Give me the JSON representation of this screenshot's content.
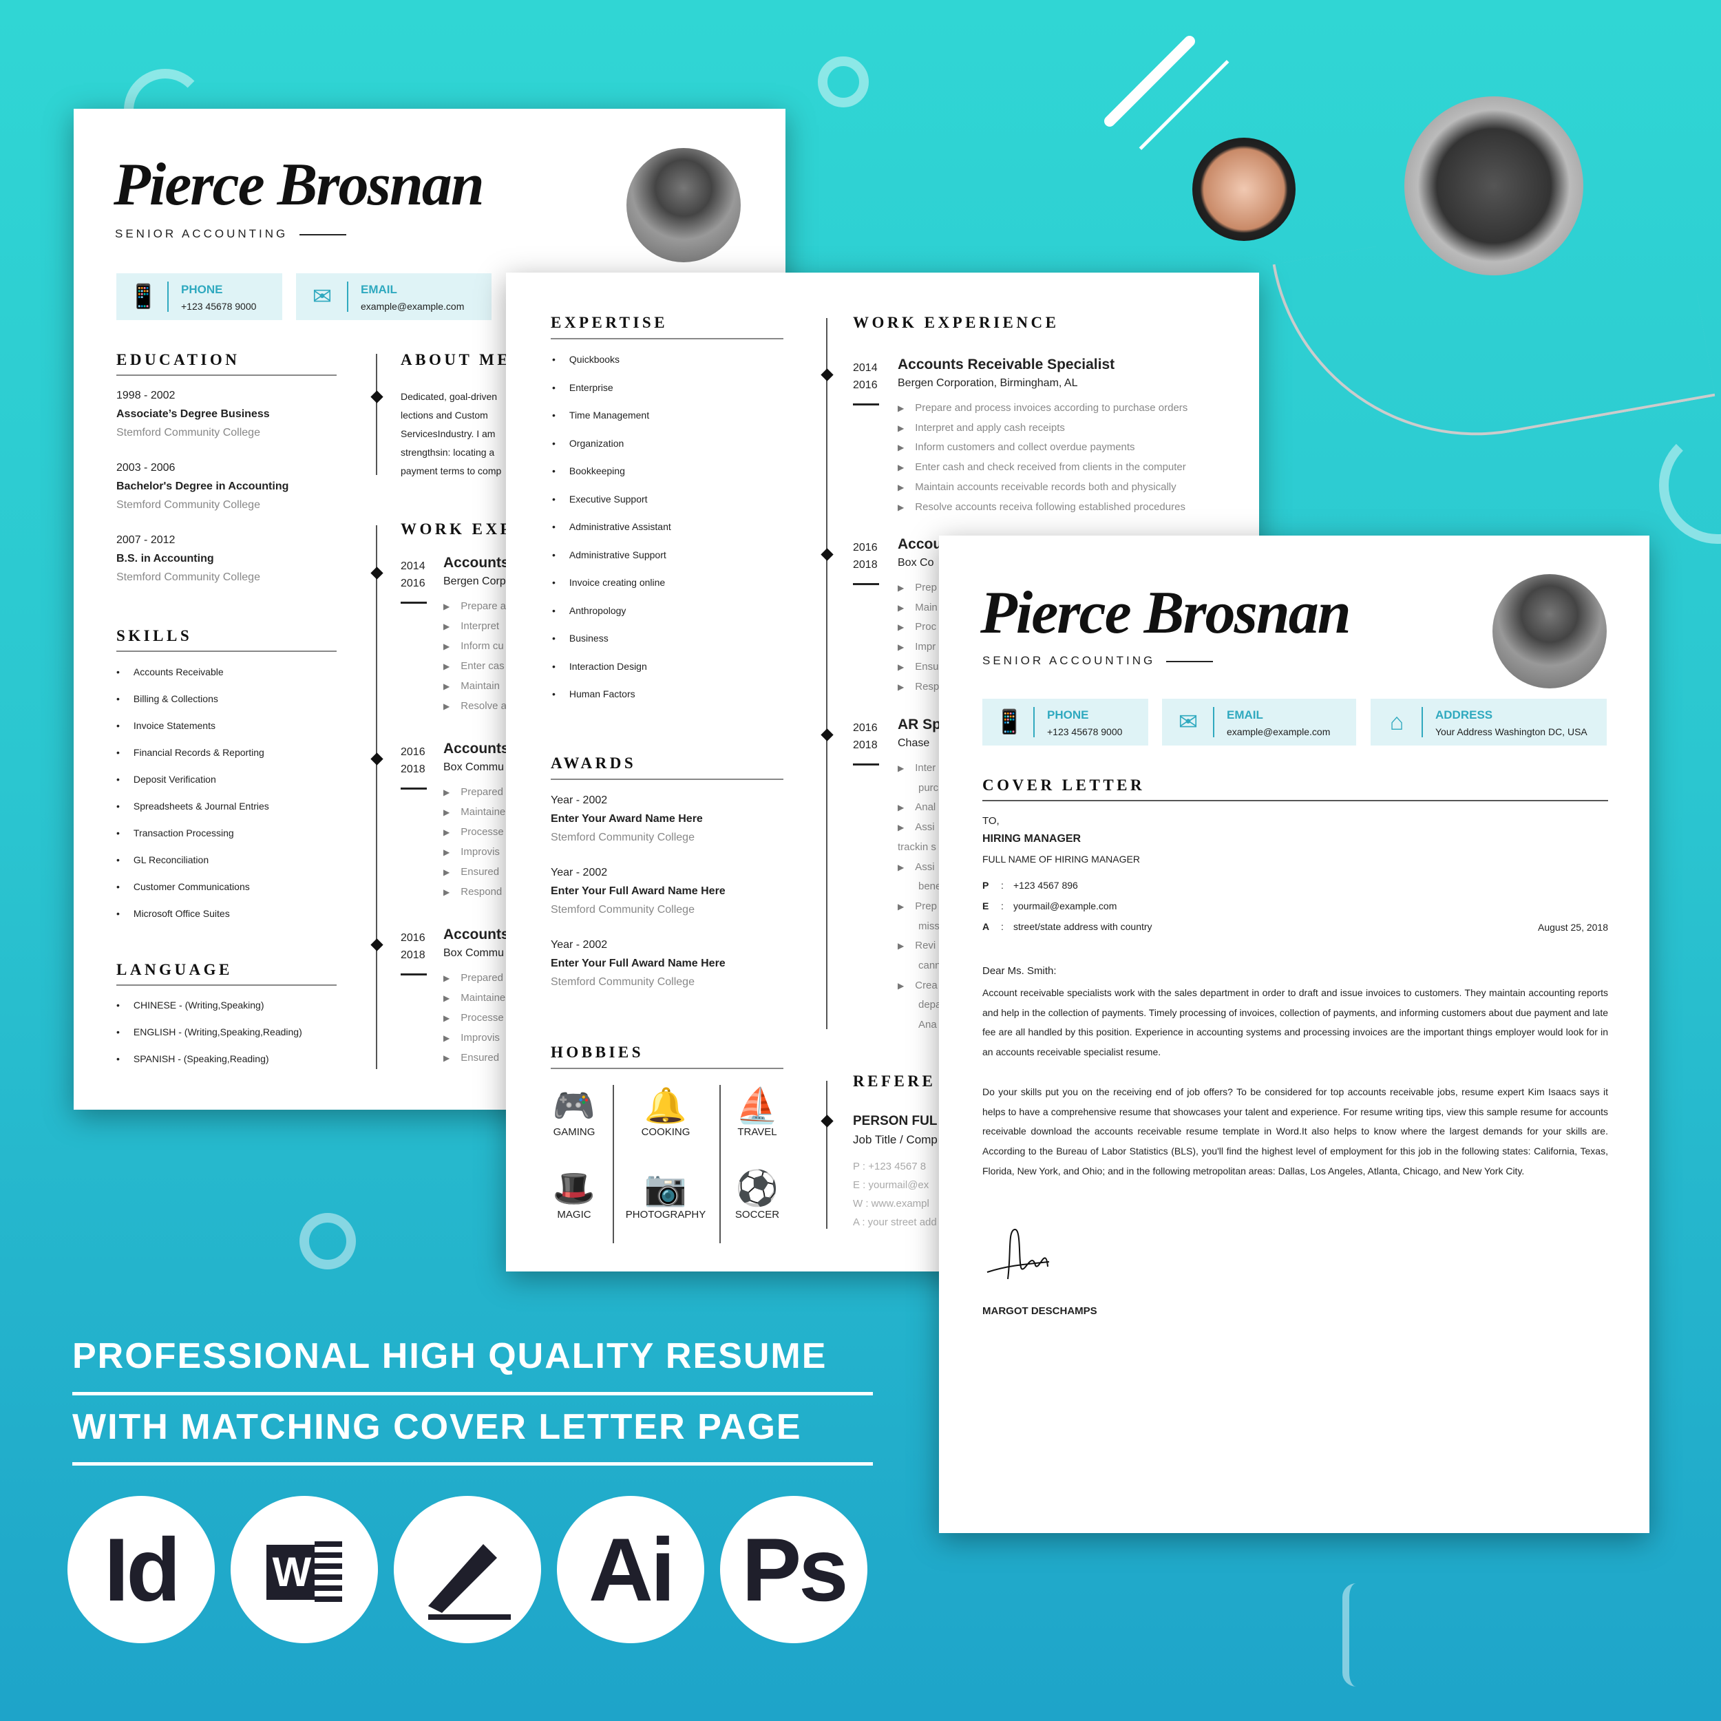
{
  "colors": {
    "accent": "#2fa9bf",
    "background_top": "#30d6d4",
    "background_bottom": "#1ea4c9",
    "contact_box": "#dff3f6"
  },
  "resume_front": {
    "name": "Pierce Brosnan",
    "title": "SENIOR ACCOUNTING",
    "contacts": [
      {
        "label": "PHONE",
        "value": "+123 45678 9000",
        "icon": "phone-icon"
      },
      {
        "label": "EMAIL",
        "value": "example@example.com",
        "icon": "envelope-icon"
      }
    ],
    "education_heading": "EDUCATION",
    "education": [
      {
        "years": "1998 - 2002",
        "degree": "Associate’s Degree Business",
        "school": "Stemford Community College"
      },
      {
        "years": "2003 - 2006",
        "degree": "Bachelor's Degree in Accounting",
        "school": "Stemford Community College"
      },
      {
        "years": "2007 - 2012",
        "degree": "B.S. in Accounting",
        "school": "Stemford Community College"
      }
    ],
    "skills_heading": "SKILLS",
    "skills": [
      "Accounts Receivable",
      "Billing & Collections",
      "Invoice Statements",
      "Financial Records & Reporting",
      "Deposit Verification",
      "Spreadsheets & Journal Entries",
      "Transaction Processing",
      "GL Reconciliation",
      "Customer Communications",
      "Microsoft Office Suites"
    ],
    "language_heading": "LANGUAGE",
    "languages": [
      "CHINESE  -  (Writing,Speaking)",
      "ENGLISH  -  (Writing,Speaking,Reading)",
      "SPANISH  -  (Speaking,Reading)"
    ],
    "about_heading": "ABOUT ME",
    "about_lines": [
      "Dedicated, goal-driven",
      "lections   and   Custom",
      "ServicesIndustry. I am",
      "strengthsin: locating a",
      "payment terms to comp"
    ],
    "work_heading": "WORK EXP",
    "work": [
      {
        "start": "2014",
        "end": "2016",
        "title": "Accounts",
        "company": "Bergen Corp",
        "bullets": [
          "Prepare a",
          "Interpret",
          "Inform cu",
          "Enter cas",
          "Maintain",
          "Resolve a"
        ]
      },
      {
        "start": "2016",
        "end": "2018",
        "title": "Accounts",
        "company": "Box Commu",
        "bullets": [
          "Prepared",
          "Maintaine",
          "Processe",
          "Improvis",
          "Ensured",
          "Respond"
        ]
      },
      {
        "start": "2016",
        "end": "2018",
        "title": "Accounts",
        "company": "Box Commu",
        "bullets": [
          "Prepared",
          "Maintaine",
          "Processe",
          "Improvis",
          "Ensured"
        ]
      }
    ]
  },
  "resume_back": {
    "expertise_heading": "EXPERTISE",
    "expertise": [
      "Quickbooks",
      "Enterprise",
      "Time Management",
      "Organization",
      "Bookkeeping",
      "Executive Support",
      "Administrative Assistant",
      "Administrative Support",
      "Invoice creating online",
      "Anthropology",
      "Business",
      "Interaction Design",
      "Human Factors"
    ],
    "awards_heading": "AWARDS",
    "awards": [
      {
        "year": "Year - 2002",
        "name": "Enter Your Award Name Here",
        "school": "Stemford Community College"
      },
      {
        "year": "Year - 2002",
        "name": "Enter Your Full Award Name Here",
        "school": "Stemford Community College"
      },
      {
        "year": "Year - 2002",
        "name": "Enter Your Full Award Name Here",
        "school": "Stemford Community College"
      }
    ],
    "hobbies_heading": "HOBBIES",
    "hobbies": [
      {
        "name": "GAMING",
        "icon": "gamepad-icon"
      },
      {
        "name": "COOKING",
        "icon": "cloche-icon"
      },
      {
        "name": "TRAVEL",
        "icon": "ship-icon"
      },
      {
        "name": "MAGIC",
        "icon": "magic-hat-icon"
      },
      {
        "name": "PHOTOGRAPHY",
        "icon": "camera-icon"
      },
      {
        "name": "SOCCER",
        "icon": "soccer-ball-icon"
      }
    ],
    "work_heading": "WORK EXPERIENCE",
    "work": [
      {
        "start": "2014",
        "end": "2016",
        "title": "Accounts Receivable Specialist",
        "company": "Bergen Corporation, Birmingham, AL",
        "bullets": [
          "Prepare and process invoices according to purchase orders",
          "Interpret and apply cash receipts",
          "Inform customers and collect overdue payments",
          "Enter cash and check received from clients in the computer",
          "Maintain accounts receivable records both and physically",
          "Resolve accounts receiva following established procedures"
        ]
      },
      {
        "start": "2016",
        "end": "2018",
        "title": "Accou",
        "company": "Box Co",
        "bullets": [
          "Prep",
          "Main",
          "Proc",
          "Impr",
          "Ensu",
          "Resp"
        ]
      },
      {
        "start": "2016",
        "end": "2018",
        "title": "AR Sp",
        "company": "Chase ",
        "bullets": [
          "Inter",
          "purc",
          "Anal",
          "Assi",
          "trackin s",
          "Assi",
          "bene",
          "Prep",
          "miss",
          "Revi",
          "cann",
          "Crea",
          "depa",
          "Ana"
        ]
      }
    ],
    "references_heading": "REFERE",
    "reference": {
      "name": "PERSON FUL",
      "job": "Job Title / Comp",
      "lines": [
        "P  :  +123 4567 8",
        "E  :  yourmail@ex",
        "W :  www.exampl",
        "A : your street add"
      ]
    }
  },
  "cover_letter": {
    "name": "Pierce Brosnan",
    "title": "SENIOR ACCOUNTING",
    "contacts": [
      {
        "label": "PHONE",
        "value": "+123 45678 9000",
        "icon": "phone-icon"
      },
      {
        "label": "EMAIL",
        "value": "example@example.com",
        "icon": "envelope-icon"
      },
      {
        "label": "ADDRESS",
        "value": "Your Address Washington DC, USA",
        "icon": "house-icon"
      }
    ],
    "heading": "COVER LETTER",
    "to": "TO,",
    "recipient": "HIRING MANAGER",
    "recipient_name": "FULL NAME OF HIRING MANAGER",
    "details": [
      {
        "k": "P",
        "v": "+123 4567 896"
      },
      {
        "k": "E",
        "v": "yourmail@example.com"
      },
      {
        "k": "A",
        "v": "street/state address with country"
      }
    ],
    "date": "August 25, 2018",
    "salutation": "Dear Ms. Smith:",
    "paragraphs": [
      "Account receivable specialists work with the sales department in order to draft and issue invoices to customers. They maintain accounting reports and help in the collection of payments. Timely processing of invoices, collection of payments, and informing customers about due payment and late fee are all handled by this position.  Experience in accounting systems and processing invoices are the important things employer would look for in an accounts receivable specialist resume.",
      "Do your skills put you on the receiving end of job offers? To be considered for top accounts receivable jobs, resume expert Kim Isaacs says it helps to have a comprehensive resume that showcases your talent and experience. For resume writing tips, view this sample resume for accounts receivable download the accounts receivable resume template in Word.It also helps to know where the largest demands for your skills are. According to the Bureau of Labor Statistics (BLS), you'll find the highest level of employment for this job in the following states: California, Texas, Florida, New York, and Ohio; and in the following metropolitan areas: Dallas, Los Angeles, Atlanta, Chicago, and New York City."
    ],
    "signer": "MARGOT DESCHAMPS"
  },
  "promo": {
    "line1": "PROFESSIONAL HIGH QUALITY  RESUME",
    "line2": "WITH MATCHING COVER LETTER PAGE"
  },
  "software_logos": [
    {
      "text": "Id",
      "icon": "indesign-icon"
    },
    {
      "text": "W",
      "icon": "word-icon"
    },
    {
      "text": "",
      "icon": "pen-icon"
    },
    {
      "text": "Ai",
      "icon": "illustrator-icon"
    },
    {
      "text": "Ps",
      "icon": "photoshop-icon"
    }
  ]
}
